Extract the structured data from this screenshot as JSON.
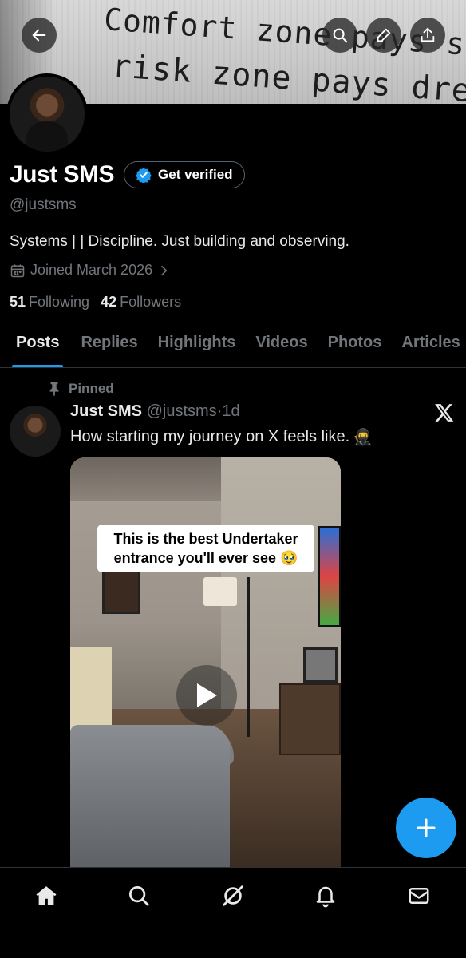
{
  "banner": {
    "line1": "Comfort zone pays salary",
    "line2": "risk zone pays dreams."
  },
  "top_buttons": [
    "back-icon",
    "search-icon",
    "edit-icon",
    "share-icon"
  ],
  "profile": {
    "display_name": "Just SMS",
    "verify_label": "Get verified",
    "handle": "@justsms",
    "bio": "Systems | | Discipline. Just building and observing.",
    "joined": "Joined March 2026",
    "following_count": "51",
    "following_label": "Following",
    "followers_count": "42",
    "followers_label": "Followers"
  },
  "tabs": [
    {
      "label": "Posts",
      "active": true
    },
    {
      "label": "Replies"
    },
    {
      "label": "Highlights"
    },
    {
      "label": "Videos"
    },
    {
      "label": "Photos"
    },
    {
      "label": "Articles"
    }
  ],
  "post": {
    "pinned_label": "Pinned",
    "author": "Just SMS",
    "handle": "@justsms",
    "separator": "·",
    "time": "1d",
    "text": "How starting my journey on X feels like.",
    "emoji": "🥷",
    "video_caption_line1": "This is the best Undertaker",
    "video_caption_line2": "entrance you'll ever see 🥹"
  },
  "colors": {
    "accent": "#1d9bf0",
    "muted": "#71767b",
    "text": "#e7e9ea",
    "divider": "#2f3336"
  },
  "bottom_nav": [
    "home-icon",
    "search-icon",
    "grok-icon",
    "notifications-icon",
    "messages-icon"
  ]
}
